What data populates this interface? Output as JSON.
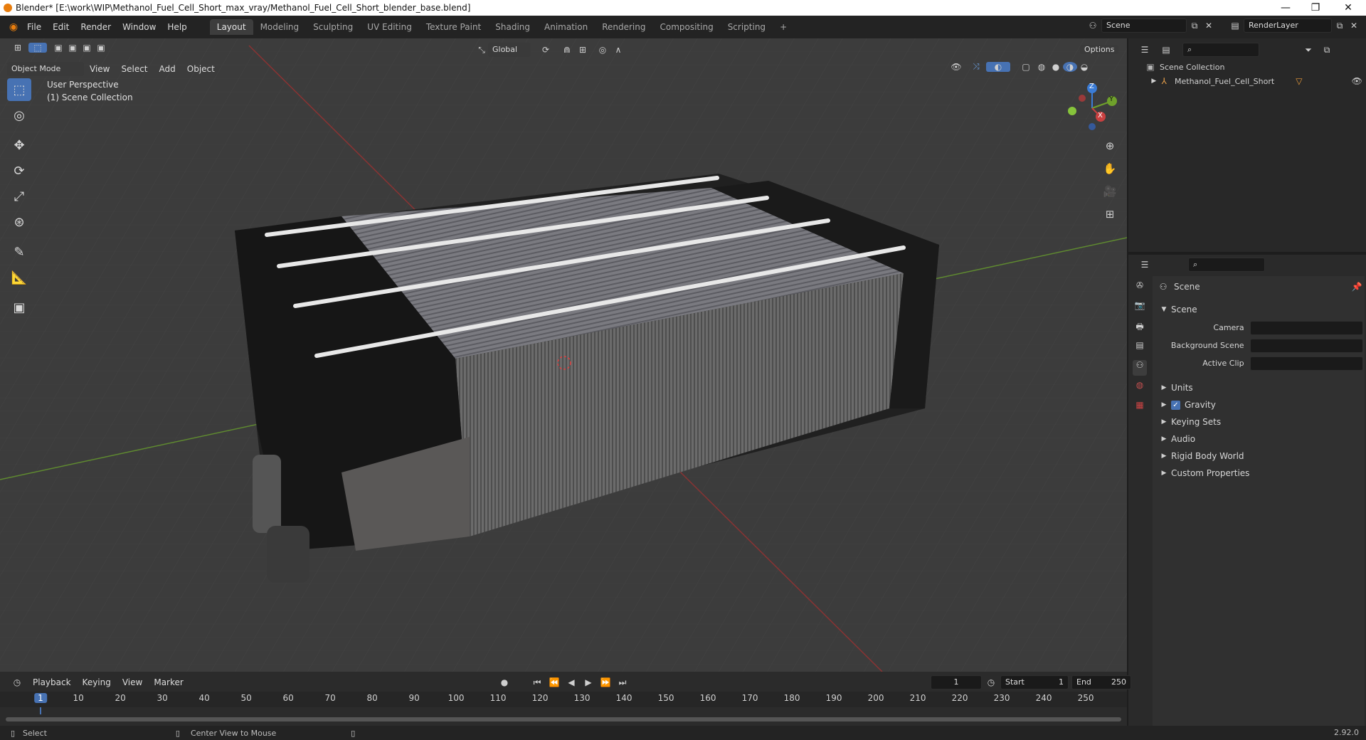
{
  "window": {
    "title": "Blender* [E:\\work\\WIP\\Methanol_Fuel_Cell_Short_max_vray/Methanol_Fuel_Cell_Short_blender_base.blend]",
    "minimize": "—",
    "maximize": "❐",
    "close": "✕"
  },
  "menu": [
    "File",
    "Edit",
    "Render",
    "Window",
    "Help"
  ],
  "workspaces": [
    "Layout",
    "Modeling",
    "Sculpting",
    "UV Editing",
    "Texture Paint",
    "Shading",
    "Animation",
    "Rendering",
    "Compositing",
    "Scripting"
  ],
  "workspace_add": "+",
  "scene_field": "Scene",
  "renderlayer_field": "RenderLayer",
  "viewport": {
    "transform_orientation": "Global",
    "options_label": "Options",
    "mode_label": "Object Mode",
    "header_menus": [
      "View",
      "Select",
      "Add",
      "Object"
    ],
    "overlay_line1": "User Perspective",
    "overlay_line2": "(1) Scene Collection",
    "gizmo_axes": {
      "x": "X",
      "y": "Y",
      "z": "Z"
    }
  },
  "outliner": {
    "root": "Scene Collection",
    "item": "Methanol_Fuel_Cell_Short"
  },
  "properties": {
    "title": "Scene",
    "panel": "Scene",
    "fields": [
      {
        "label": "Camera",
        "value": ""
      },
      {
        "label": "Background Scene",
        "value": ""
      },
      {
        "label": "Active Clip",
        "value": ""
      }
    ],
    "sections": [
      "Units",
      "Gravity",
      "Keying Sets",
      "Audio",
      "Rigid Body World",
      "Custom Properties"
    ],
    "gravity_checked": true
  },
  "timeline": {
    "menus": [
      "Playback",
      "Keying",
      "View",
      "Marker"
    ],
    "current_frame": "1",
    "start_label": "Start",
    "start_value": "1",
    "end_label": "End",
    "end_value": "250",
    "ticks": [
      "1",
      "10",
      "20",
      "30",
      "40",
      "50",
      "60",
      "70",
      "80",
      "90",
      "100",
      "110",
      "120",
      "130",
      "140",
      "150",
      "160",
      "170",
      "180",
      "190",
      "200",
      "210",
      "220",
      "230",
      "240",
      "250"
    ]
  },
  "status": {
    "left": "Select",
    "middle": "Center View to Mouse",
    "version": "2.92.0"
  },
  "colors": {
    "accent": "#4772b3",
    "axis_x": "#c94040",
    "axis_y": "#6fa12b",
    "axis_z": "#3b7cd6",
    "viewport_bg": "#3c3c3c"
  }
}
